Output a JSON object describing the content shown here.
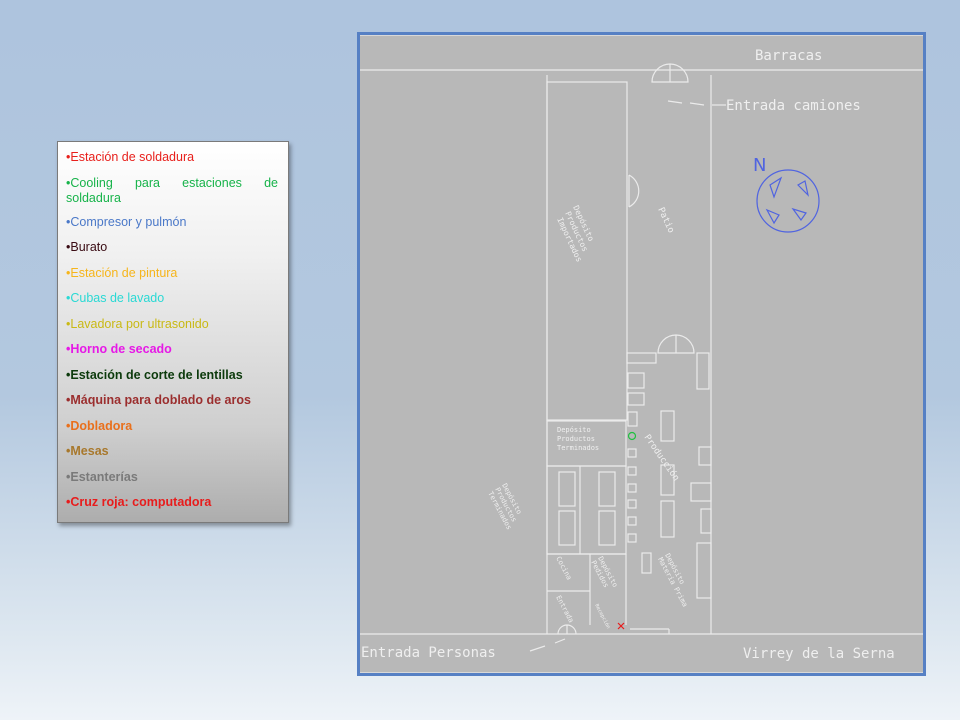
{
  "legend": {
    "items": [
      {
        "label": "Estación de soldadura",
        "color": "#e8201c",
        "bold": false
      },
      {
        "label": "Cooling para estaciones de soldadura",
        "color": "#17b34a",
        "bold": false
      },
      {
        "label": "Compresor y pulmón",
        "color": "#4a78c8",
        "bold": false
      },
      {
        "label": "Burato",
        "color": "#3a0c14",
        "bold": false
      },
      {
        "label": "Estación de pintura",
        "color": "#f6b51b",
        "bold": false
      },
      {
        "label": "Cubas de lavado",
        "color": "#2ad9d4",
        "bold": false
      },
      {
        "label": "Lavadora por ultrasonido",
        "color": "#c9b914",
        "bold": false
      },
      {
        "label": "Horno de secado",
        "color": "#e619e6",
        "bold": true
      },
      {
        "label": "Estación de corte de lentillas",
        "color": "#0c3a0c",
        "bold": true
      },
      {
        "label": "Máquina para doblado de aros",
        "color": "#9b2e2e",
        "bold": true
      },
      {
        "label": "Dobladora",
        "color": "#e9701c",
        "bold": true
      },
      {
        "label": "Mesas",
        "color": "#a8782c",
        "bold": true
      },
      {
        "label": "Estanterías",
        "color": "#7a7a7a",
        "bold": true
      },
      {
        "label": "Cruz roja: computadora",
        "color": "#e81c1c",
        "bold": true
      }
    ]
  },
  "plan": {
    "street_top": "Barracas",
    "entrada_camiones": "Entrada camiones",
    "north": "N",
    "patio": "Patio",
    "deposito_importados": [
      "Depósito",
      "Productos",
      "Importados"
    ],
    "deposito_terminados_box": [
      "Depósito",
      "Productos",
      "Terminados"
    ],
    "produccion": "Producción",
    "deposito_terminados_rot": [
      "Depósito",
      "Productos",
      "Terminados"
    ],
    "cocina": "Cocina",
    "deposito_pedidos": [
      "Depósito",
      "Pedidos"
    ],
    "deposito_materia_prima": [
      "Depósito",
      "Materia Prima"
    ],
    "entrada_small": "Entrada",
    "recepcion": "Recepción",
    "entrada_personas": "Entrada Personas",
    "street_bottom": "Virrey de la Serna",
    "colors": {
      "frame": "#5680c4",
      "background": "#b8b8b8",
      "north_arrow": "#5064e0"
    }
  }
}
